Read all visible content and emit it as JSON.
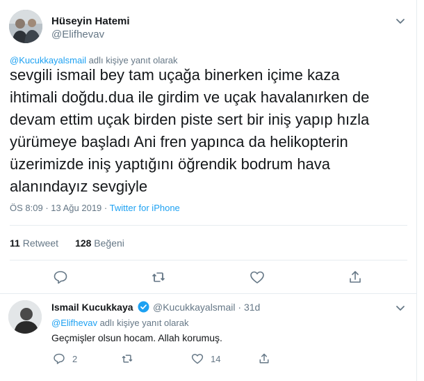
{
  "tweet": {
    "author_name": "Hüseyin Hatemi",
    "author_handle": "@Elifhevav",
    "reply_to_mention": "@Kucukkayalsmail",
    "reply_to_suffix": " adlı kişiye yanıt olarak",
    "text": "sevgili ismail bey tam uçağa binerken içime kaza\nihtimali doğdu.dua ile girdim ve uçak havalanırken de\ndevam ettim uçak birden piste sert bir iniş yapıp hızla\nyürümeye başladı Ani fren yapınca da helikopterin\nüzerimizde iniş yaptığını öğrendik  bodrum hava\nalanındayız sevgiyle",
    "time": "ÖS 8:09",
    "separator": " · ",
    "date": "13 Ağu 2019",
    "source": "Twitter for iPhone",
    "retweet_count": "11",
    "retweet_label": " Retweet",
    "like_count": "128",
    "like_label": " Beğeni"
  },
  "reply": {
    "author_name": "Ismail Kucukkaya",
    "author_handle": "@Kucukkayalsmail",
    "separator": " · ",
    "age": "31d",
    "reply_to_mention": "@Elifhevav",
    "reply_to_suffix": " adlı kişiye yanıt olarak",
    "text": "Geçmişler olsun hocam. Allah korumuş.",
    "reply_count": "2",
    "retweet_count": "",
    "like_count": "14"
  },
  "icons": {
    "caret": "chevron-down-icon",
    "reply": "speech-bubble-icon",
    "retweet": "retweet-arrows-icon",
    "like": "heart-icon",
    "share": "share-arrow-icon",
    "verified": "verified-badge-icon"
  },
  "colors": {
    "link": "#1da1f2",
    "muted": "#657786",
    "text": "#14171a",
    "border": "#e6ecf0"
  }
}
